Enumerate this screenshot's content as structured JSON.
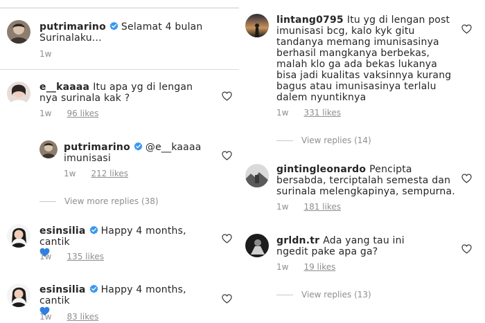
{
  "left": {
    "comments": [
      {
        "username": "putrimarino",
        "verified": true,
        "text": "Selamat 4 bulan Surinalaku...",
        "time": "1w",
        "likes": ""
      },
      {
        "username": "e__kaaaa",
        "verified": false,
        "text": "Itu apa yg di lengan nya surinala kak ?",
        "time": "1w",
        "likes": "96 likes"
      },
      {
        "username": "putrimarino",
        "verified": true,
        "mention": "@e__kaaaa",
        "text": "imunisasi",
        "time": "1w",
        "likes": "212 likes"
      },
      {
        "username": "esinsilia",
        "verified": true,
        "text": "Happy 4 months, cantik",
        "time": "1w",
        "likes": "135 likes"
      },
      {
        "username": "esinsilia",
        "verified": true,
        "text": "Happy 4 months, cantik",
        "time": "1w",
        "likes": "83 likes"
      }
    ],
    "view_more_replies": "View more replies (38)"
  },
  "right": {
    "comments": [
      {
        "username": "lintang0795",
        "verified": false,
        "text": "Itu yg di lengan post imunisasi bcg, kalo kyk gitu tandanya memang imunisasinya berhasil mangkanya berbekas, malah klo ga ada bekas lukanya bisa jadi kualitas vaksinnya kurang bagus atau imunisasinya terlalu dalem nyuntiknya",
        "time": "1w",
        "likes": "331 likes",
        "view_replies": "View replies (14)"
      },
      {
        "username": "gintingleonardo",
        "verified": false,
        "text": "Pencipta bersabda, terciptalah semesta dan surinala melengkapinya, sempurna.",
        "time": "1w",
        "likes": "181 likes"
      },
      {
        "username": "grldn.tr",
        "verified": false,
        "text": "Ada yang tau ini ngedit pake apa ga?",
        "time": "1w",
        "likes": "19 likes",
        "view_replies": "View replies (13)"
      }
    ]
  },
  "colors": {
    "text": "#262626",
    "muted": "#8e8e8e",
    "verified": "#3897f0",
    "emoji_heart": "#2f7fe0"
  },
  "icons": {
    "heart": "heart-outline-icon",
    "verified": "verified-badge-icon",
    "emoji": "blue-heart-emoji"
  }
}
